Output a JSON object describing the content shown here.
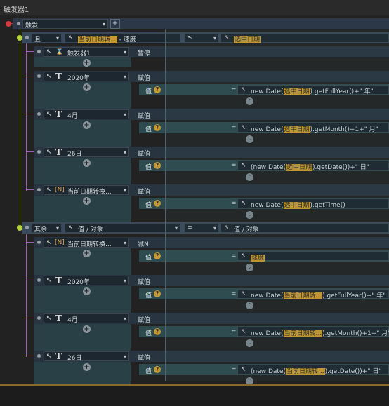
{
  "window": {
    "title": "触发器1"
  },
  "trigger": {
    "label": "触发"
  },
  "cond_if": {
    "label": "且",
    "left": "当前日期转...",
    "left_suffix": "- 速度",
    "op": "≤",
    "right": "选中日期"
  },
  "cond_else": {
    "label": "其余",
    "left": "值 / 对象",
    "op": "=",
    "right": "值 / 对象"
  },
  "common": {
    "assign": "赋值",
    "value": "值",
    "eq": "=",
    "new_date": "new Date(",
    "paren_new": "(new Date("
  },
  "actions_if": [
    {
      "name": "触发器1",
      "verb": "暂停",
      "icon": "hourglass"
    },
    {
      "name": "2020年",
      "verb": "赋值",
      "arg": "选中日期",
      "tail": ").getFullYear()+\" 年\"",
      "icon": "T"
    },
    {
      "name": "4月",
      "verb": "赋值",
      "arg": "选中日期",
      "tail": ").getMonth()+1+\" 月\"",
      "icon": "T"
    },
    {
      "name": "26日",
      "verb": "赋值",
      "arg": "选中日期",
      "tail": ").getDate())+\" 日\"",
      "icon": "T",
      "paren": true
    },
    {
      "name": "当前日期转换...",
      "verb": "赋值",
      "arg": "选中日期",
      "tail": ").getTime()",
      "icon": "N"
    }
  ],
  "actions_else": [
    {
      "name": "当前日期转换...",
      "verb": "减N",
      "arg": "速度",
      "icon": "N"
    },
    {
      "name": "2020年",
      "verb": "赋值",
      "arg": "当前日期转...",
      "tail": ").getFullYear()+\" 年\"",
      "icon": "T"
    },
    {
      "name": "4月",
      "verb": "赋值",
      "arg": "当前日期转...",
      "tail": ").getMonth()+1+\" 月\"",
      "icon": "T"
    },
    {
      "name": "26日",
      "verb": "赋值",
      "arg": "当前日期转...",
      "tail": ").getDate())+\" 日\"",
      "icon": "T",
      "paren": true
    }
  ],
  "glyphs": {
    "plus": "+",
    "chev_down": "⌄",
    "chev_up": "⌃",
    "q": "?",
    "arrow": "▾",
    "cursor": "↖",
    "N": "[N]",
    "T": "T",
    "hourglass": "⌛"
  },
  "colors": {
    "accent_green": "#b4d33b",
    "highlight": "#c89a2d",
    "purple_line": "#9c5fb5"
  }
}
